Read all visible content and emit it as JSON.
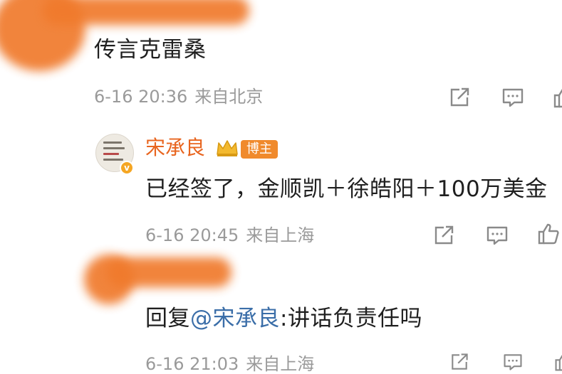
{
  "comments": [
    {
      "content": "传言克雷桑",
      "time": "6-16 20:36",
      "location": "来自北京"
    },
    {
      "username": "宋承良",
      "badge_label": "博主",
      "content": "已经签了，金顺凯＋徐皓阳＋100万美金",
      "time": "6-16 20:45",
      "location": "来自上海"
    },
    {
      "reply_prefix": "回复",
      "mention": "@宋承良",
      "reply_text": ":讲话负责任吗",
      "time": "6-16 21:03",
      "location": "来自上海"
    }
  ],
  "icons": [
    "share-icon",
    "comment-icon",
    "like-icon"
  ],
  "colors": {
    "username": "#e8651f",
    "mention": "#3b6ea8",
    "meta": "#9a9a9a",
    "smudge": "#f07a2c",
    "badge": "#f08a2c"
  }
}
